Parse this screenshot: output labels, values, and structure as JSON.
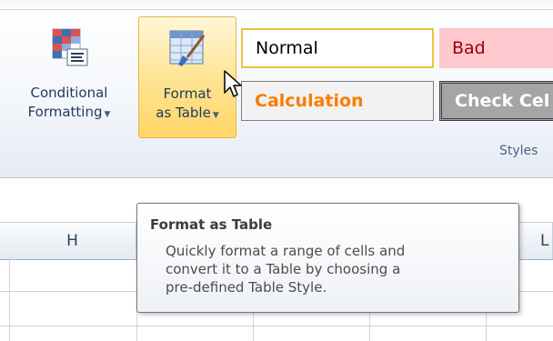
{
  "ribbon": {
    "conditional_formatting": {
      "line1": "Conditional",
      "line2": "Formatting"
    },
    "format_as_table": {
      "line1": "Format",
      "line2": "as Table"
    },
    "styles": {
      "normal": "Normal",
      "bad": "Bad",
      "calculation": "Calculation",
      "check_cell": "Check Cel"
    },
    "group_label": "Styles"
  },
  "sheet": {
    "columns": [
      "H",
      "L"
    ]
  },
  "tooltip": {
    "title": "Format as Table",
    "lines": [
      "Quickly format a range of cells and",
      "convert it to a Table by choosing a",
      "pre-defined Table Style."
    ]
  },
  "icons": {
    "conditional_formatting": "conditional-formatting-icon",
    "format_as_table": "format-as-table-icon",
    "cursor": "mouse-pointer-icon",
    "dropdown": "dropdown-arrow-icon"
  },
  "colors": {
    "hover_fill": "#ffe69b",
    "normal_border": "#f0c040",
    "bad_fill": "#ffc7ce",
    "bad_text": "#9c0006",
    "calculation_text": "#fa7d00",
    "check_cell_fill": "#a5a5a5"
  }
}
